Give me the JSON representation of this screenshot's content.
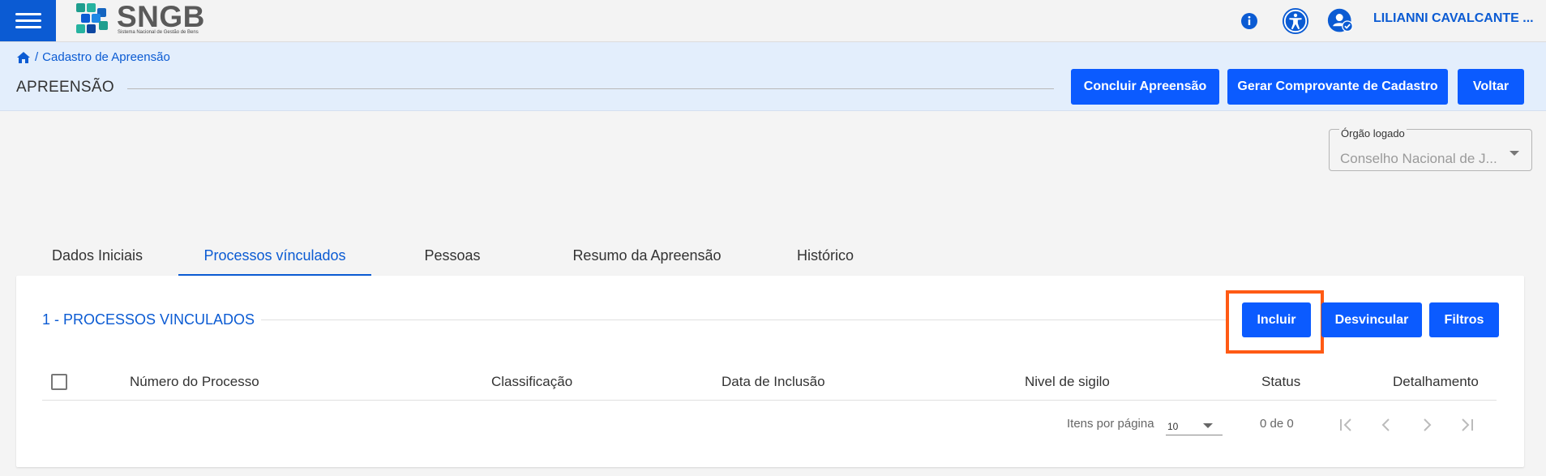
{
  "app": {
    "logo_text": "SNGB",
    "logo_subtitle": "Sistema Nacional de Gestão de Bens",
    "user_name": "LILIANNI CAVALCANTE ...",
    "brand_color": "#0b5bd3",
    "icons": {
      "menu": "hamburger-icon",
      "info": "info-icon",
      "accessibility": "accessibility-icon",
      "user": "user-verified-icon"
    }
  },
  "breadcrumb": {
    "home_icon": "home-icon",
    "separator": "/",
    "current": "Cadastro de Apreensão"
  },
  "header": {
    "title": "APREENSÃO",
    "buttons": {
      "conclude": "Concluir Apreensão",
      "receipt": "Gerar Comprovante de Cadastro",
      "back": "Voltar"
    }
  },
  "org_select": {
    "label": "Órgão logado",
    "value": "Conselho Nacional de J..."
  },
  "tabs": [
    {
      "label": "Dados Iniciais",
      "active": false
    },
    {
      "label": "Processos vínculados",
      "active": true
    },
    {
      "label": "Pessoas",
      "active": false
    },
    {
      "label": "Resumo da Apreensão",
      "active": false
    },
    {
      "label": "Histórico",
      "active": false
    }
  ],
  "section": {
    "title": "1 - PROCESSOS VINCULADOS",
    "buttons": {
      "include": "Incluir",
      "unlink": "Desvincular",
      "filters": "Filtros"
    },
    "highlight_color": "#ff5a14"
  },
  "table": {
    "columns": [
      "Número do Processo",
      "Classificação",
      "Data de Inclusão",
      "Nivel de sigilo",
      "Status",
      "Detalhamento"
    ],
    "rows": []
  },
  "paginator": {
    "items_label": "Itens por página",
    "page_size": "10",
    "range": "0 de 0"
  }
}
